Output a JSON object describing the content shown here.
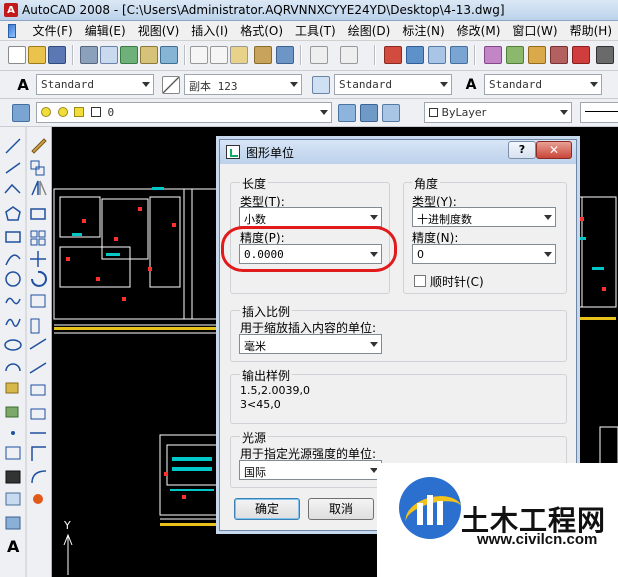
{
  "window": {
    "app": "AutoCAD 2008",
    "title": "AutoCAD 2008 - [C:\\Users\\Administrator.AQRVNNXCYYE24YD\\Desktop\\4-13.dwg]"
  },
  "menu": [
    "文件(F)",
    "编辑(E)",
    "视图(V)",
    "插入(I)",
    "格式(O)",
    "工具(T)",
    "绘图(D)",
    "标注(N)",
    "修改(M)",
    "窗口(W)",
    "帮助(H)"
  ],
  "toolbar": {
    "text_style": "Standard",
    "dim_style": "副本 123",
    "table_style": "Standard",
    "multileader_style": "Standard",
    "layer": "0",
    "color": "ByLayer"
  },
  "dialog": {
    "title": "图形单位",
    "help": "?",
    "close": "✕",
    "length": {
      "label": "长度",
      "type_label": "类型(T):",
      "type_value": "小数",
      "precision_label": "精度(P):",
      "precision_value": "0.0000"
    },
    "angle": {
      "label": "角度",
      "type_label": "类型(Y):",
      "type_value": "十进制度数",
      "precision_label": "精度(N):",
      "precision_value": "0",
      "clockwise_label": "顺时针(C)",
      "clockwise_checked": false
    },
    "insert_scale": {
      "label": "插入比例",
      "desc": "用于缩放插入内容的单位:",
      "value": "毫米"
    },
    "sample": {
      "label": "输出样例",
      "line1": "1.5,2.0039,0",
      "line2": "3<45,0"
    },
    "light": {
      "label": "光源",
      "desc": "用于指定光源强度的单位:",
      "value": "国际"
    },
    "buttons": {
      "ok": "确定",
      "cancel": "取消"
    }
  },
  "canvas": {
    "ucs_y": "Y"
  },
  "watermark": {
    "name": "土木工程网",
    "url": "www.civilcn.com"
  },
  "colors": {
    "highlight_ring": "#e11b1b",
    "canvas_bg": "#000000"
  }
}
